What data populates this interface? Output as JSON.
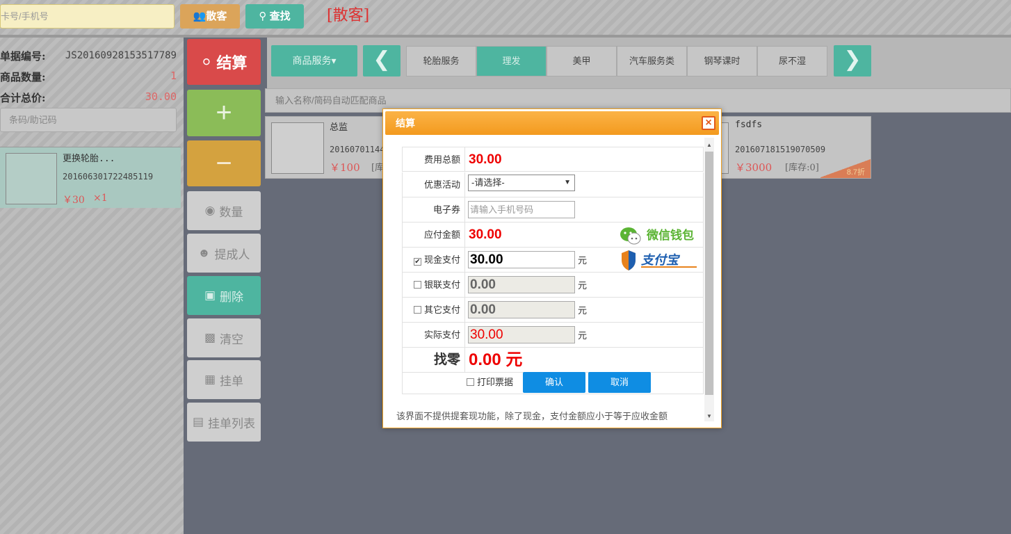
{
  "topbar": {
    "card_placeholder": "卡号/手机号",
    "guest_button": "散客",
    "search_button": "查找",
    "guest_label": "[散客]"
  },
  "bill": {
    "number_label": "单据编号:",
    "number_value": "JS20160928153517789",
    "qty_label": "商品数量:",
    "qty_value": "1",
    "total_label": "合计总价:",
    "total_value": "30.00",
    "barcode_placeholder": "条码/助记码"
  },
  "cart": [
    {
      "name": "更换轮胎...",
      "code": "201606301722485119",
      "price": "￥30",
      "qty": "×1"
    }
  ],
  "side_buttons": {
    "checkout": "结算",
    "plus": "+",
    "minus": "−",
    "qty": "数量",
    "commission": "提成人",
    "delete": "删除",
    "clear": "清空",
    "hold": "挂单",
    "hold_list": "挂单列表"
  },
  "categories": {
    "dropdown": "商品服务▾",
    "tabs": [
      "轮胎服务",
      "理发",
      "美甲",
      "汽车服务类",
      "钢琴课时",
      "尿不湿"
    ],
    "active_index": 1
  },
  "product_search_placeholder": "输入名称/简码自动匹配商品",
  "products": [
    {
      "name": "总监",
      "code": "20160701144",
      "price": "￥100",
      "stock": "[库"
    },
    {
      "name": "fsdfs",
      "code": "201607181519070509",
      "price": "￥3000",
      "stock": "[库存:0]",
      "discount": "8.7折"
    }
  ],
  "modal": {
    "title": "结算",
    "close": "×",
    "rows": {
      "total_label": "费用总额",
      "total_value": "30.00",
      "promo_label": "优惠活动",
      "promo_value": "-请选择-",
      "coupon_label": "电子券",
      "coupon_placeholder": "请输入手机号码",
      "payable_label": "应付金额",
      "payable_value": "30.00",
      "cash_label": "现金支付",
      "cash_value": "30.00",
      "unionpay_label": "银联支付",
      "unionpay_value": "0.00",
      "other_label": "其它支付",
      "other_value": "0.00",
      "actual_label": "实际支付",
      "actual_value": "30.00",
      "change_label": "找零",
      "change_value": "0.00 元",
      "unit": "元"
    },
    "wechat_text": "微信钱包",
    "alipay_text": "支付宝",
    "print_label": "打印票据",
    "confirm": "确认",
    "cancel": "取消",
    "note": "该界面不提供提套现功能，除了现金，支付金额应小于等于应收金额"
  },
  "colors": {
    "accent_teal": "#4eb5a0",
    "checkout_red": "#d94a4a",
    "modal_orange": "#f39a1e",
    "button_blue": "#0f8de3",
    "amount_red": "#e00000"
  }
}
